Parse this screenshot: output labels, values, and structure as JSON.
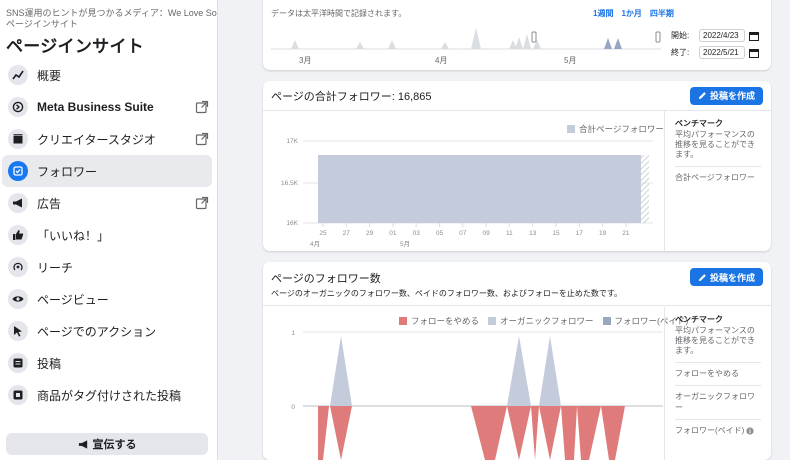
{
  "sidebar": {
    "breadcrumb": "SNS運用のヒントが見つかるメディア：We Love Social ›",
    "breadcrumb_sub": "ページインサイト",
    "title": "ページインサイト",
    "items": [
      {
        "label": "概要",
        "icon": "trend-icon",
        "external": false,
        "active": false
      },
      {
        "label": "Meta Business Suite",
        "icon": "business-suite-icon",
        "external": true,
        "active": false
      },
      {
        "label": "クリエイタースタジオ",
        "icon": "creator-studio-icon",
        "external": true,
        "active": false
      },
      {
        "label": "フォロワー",
        "icon": "followers-icon",
        "external": false,
        "active": true
      },
      {
        "label": "広告",
        "icon": "megaphone-icon",
        "external": true,
        "active": false
      },
      {
        "label": "「いいね！」",
        "icon": "thumbs-up-icon",
        "external": false,
        "active": false
      },
      {
        "label": "リーチ",
        "icon": "reach-icon",
        "external": false,
        "active": false
      },
      {
        "label": "ページビュー",
        "icon": "eye-icon",
        "external": false,
        "active": false
      },
      {
        "label": "ページでのアクション",
        "icon": "cursor-icon",
        "external": false,
        "active": false
      },
      {
        "label": "投稿",
        "icon": "posts-icon",
        "external": false,
        "active": false
      },
      {
        "label": "商品がタグ付けされた投稿",
        "icon": "tagged-product-icon",
        "external": false,
        "active": false
      }
    ],
    "promote_label": "宣伝する"
  },
  "timeline": {
    "note": "データは太平洋時間で記録されます。",
    "ranges": [
      "1週間",
      "1か月",
      "四半期"
    ],
    "month_labels": [
      "3月",
      "4月",
      "5月"
    ],
    "start_label": "開始:",
    "start_value": "2022/4/23",
    "end_label": "終了:",
    "end_value": "2022/5/21"
  },
  "total_followers": {
    "title": "ページの合計フォロワー: 16,865",
    "create_post": "投稿を作成",
    "legend": "合計ページフォロワー",
    "benchmark_title": "ベンチマーク",
    "benchmark_desc": "平均パフォーマンスの推移を見ることができます。",
    "benchmark_item": "合計ページフォロワー"
  },
  "follower_count": {
    "title": "ページのフォロワー数",
    "subtitle": "ページのオーガニックのフォロワー数、ペイドのフォロワー数、およびフォローを止めた数です。",
    "create_post": "投稿を作成",
    "benchmark_title": "ベンチマーク",
    "benchmark_desc": "平均パフォーマンスの推移を見ることができます。",
    "benchmark_items": [
      "フォローをやめる",
      "オーガニックフォロワー",
      "フォロワー(ペイド)"
    ],
    "info_icon": "info-icon"
  },
  "chart_data": [
    {
      "type": "area",
      "title": "ページの合計フォロワー: 16,865",
      "series": [
        {
          "name": "合計ページフォロワー",
          "color": "#c4cbdb"
        }
      ],
      "y_ticks": [
        "17K",
        "16.5K",
        "16K"
      ],
      "x_ticks": [
        "25",
        "27",
        "29",
        "01",
        "03",
        "05",
        "07",
        "09",
        "11",
        "13",
        "15",
        "17",
        "19",
        "21"
      ],
      "x_month_labels": [
        "4月",
        "5月"
      ],
      "grid": true,
      "legend_position": "top-right"
    },
    {
      "type": "area",
      "title": "ページのフォロワー数",
      "series": [
        {
          "name": "フォローをやめる",
          "color": "#e07b7b"
        },
        {
          "name": "オーガニックフォロワー",
          "color": "#c4cbdb"
        },
        {
          "name": "フォロワー(ペイド)",
          "color": "#9aa5c3"
        }
      ],
      "y_ticks": [
        "1",
        "0"
      ],
      "grid": true,
      "legend_position": "top-center"
    }
  ],
  "colors": {
    "accent": "#1b74e4",
    "series_gray": "#c4cbdb",
    "unfollow": "#e07b7b",
    "paid": "#9aa5c3"
  }
}
